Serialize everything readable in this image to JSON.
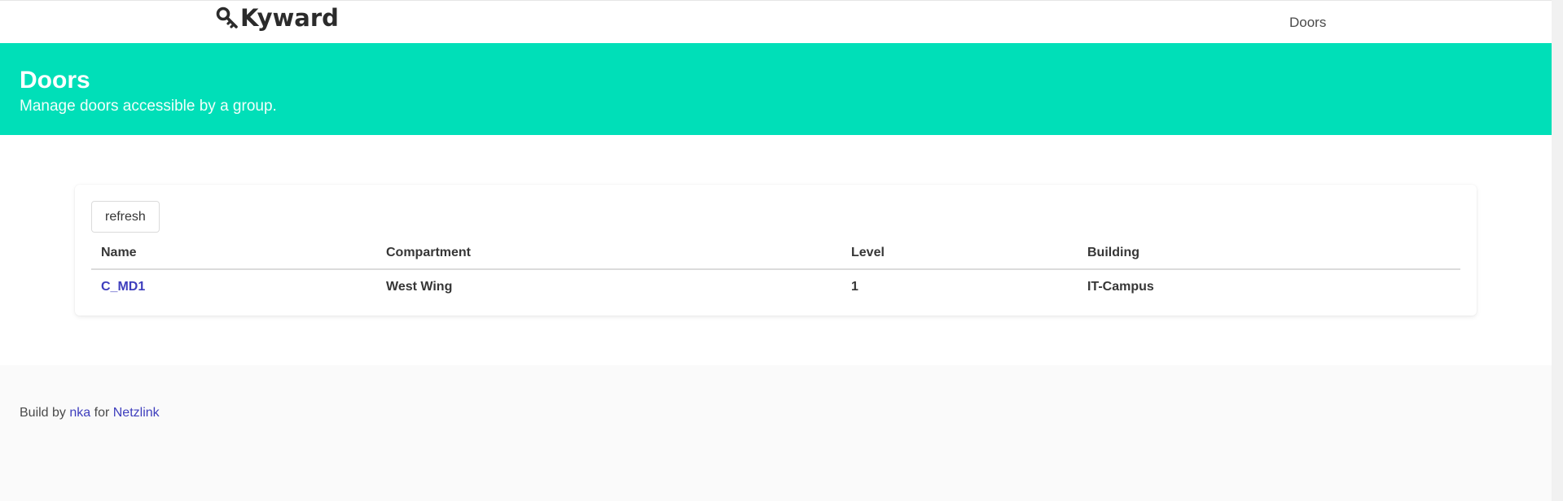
{
  "navbar": {
    "brand": "Kyward",
    "items": [
      {
        "label": "Doors"
      }
    ]
  },
  "hero": {
    "title": "Doors",
    "subtitle": "Manage doors accessible by a group."
  },
  "card": {
    "refresh_label": "refresh",
    "table": {
      "columns": [
        "Name",
        "Compartment",
        "Level",
        "Building"
      ],
      "rows": [
        {
          "name": "C_MD1",
          "compartment": "West Wing",
          "level": "1",
          "building": "IT-Campus"
        }
      ]
    }
  },
  "footer": {
    "prefix": "Build by",
    "author": "nka",
    "middle": "for",
    "org": "Netzlink"
  },
  "colors": {
    "hero_bg": "#00dfb8",
    "link": "#3e3ebd",
    "footer_bg": "#fafafa"
  },
  "icons": {
    "brand": "key-icon"
  }
}
